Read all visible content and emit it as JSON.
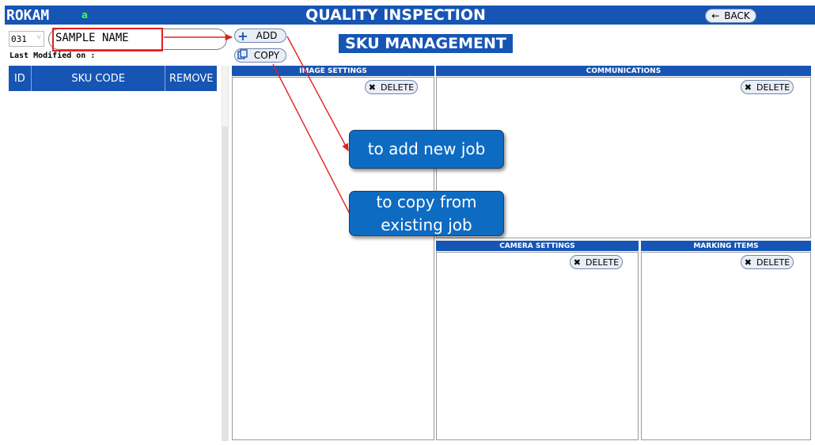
{
  "header": {
    "brand": "ROKAM",
    "brand_sub": "a",
    "title": "QUALITY INSPECTION",
    "back_label": "BACK"
  },
  "sku": {
    "id_value": "031",
    "name_value": "SAMPLE NAME",
    "last_modified_label": "Last Modified on :",
    "columns": [
      "ID",
      "SKU CODE",
      "REMOVE"
    ],
    "add_label": "ADD",
    "copy_label": "COPY",
    "section_title": "SKU MANAGEMENT"
  },
  "panels": {
    "image_settings": "IMAGE SETTINGS",
    "communications": "COMMUNICATIONS",
    "camera_settings": "CAMERA SETTINGS",
    "marking_items": "MARKING ITEMS",
    "delete_label": "DELETE"
  },
  "annotations": {
    "add_note": "to add new job",
    "copy_note": "to copy from existing job"
  },
  "colors": {
    "primary": "#1655b4",
    "callout": "#0e6bc2",
    "annotation_red": "#e02020"
  }
}
